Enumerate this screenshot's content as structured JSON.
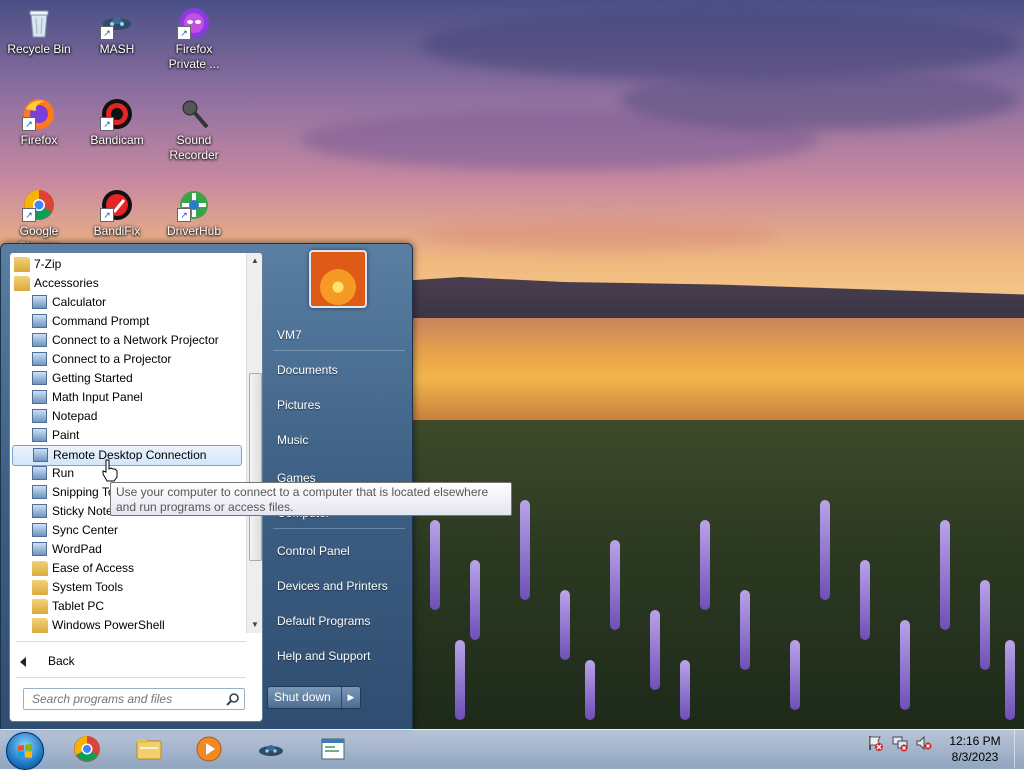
{
  "desktop": {
    "icons": [
      {
        "label": "Recycle Bin"
      },
      {
        "label": "MASH"
      },
      {
        "label": "Firefox Private ..."
      },
      {
        "label": "Firefox"
      },
      {
        "label": "Bandicam"
      },
      {
        "label": "Sound Recorder"
      },
      {
        "label": "Google Chrome"
      },
      {
        "label": "BandiFix"
      },
      {
        "label": "DriverHub"
      }
    ]
  },
  "start_menu": {
    "programs": [
      {
        "label": "7-Zip",
        "type": "folder"
      },
      {
        "label": "Accessories",
        "type": "folder"
      },
      {
        "label": "Calculator",
        "type": "app"
      },
      {
        "label": "Command Prompt",
        "type": "app"
      },
      {
        "label": "Connect to a Network Projector",
        "type": "app"
      },
      {
        "label": "Connect to a Projector",
        "type": "app"
      },
      {
        "label": "Getting Started",
        "type": "app"
      },
      {
        "label": "Math Input Panel",
        "type": "app"
      },
      {
        "label": "Notepad",
        "type": "app"
      },
      {
        "label": "Paint",
        "type": "app"
      },
      {
        "label": "Remote Desktop Connection",
        "type": "app",
        "highlighted": true
      },
      {
        "label": "Run",
        "type": "app"
      },
      {
        "label": "Snipping Tool",
        "type": "app"
      },
      {
        "label": "Sticky Notes",
        "type": "app"
      },
      {
        "label": "Sync Center",
        "type": "app"
      },
      {
        "label": "WordPad",
        "type": "app"
      },
      {
        "label": "Ease of Access",
        "type": "folder"
      },
      {
        "label": "System Tools",
        "type": "folder"
      },
      {
        "label": "Tablet PC",
        "type": "folder"
      },
      {
        "label": "Windows PowerShell",
        "type": "folder"
      }
    ],
    "back_label": "Back",
    "search_placeholder": "Search programs and files",
    "right_items": [
      "VM7",
      "Documents",
      "Pictures",
      "Music",
      "Games",
      "Computer",
      "Control Panel",
      "Devices and Printers",
      "Default Programs",
      "Help and Support"
    ],
    "shutdown_label": "Shut down"
  },
  "tooltip": {
    "text": "Use your computer to connect to a computer that is located elsewhere and run programs or access files."
  },
  "taskbar": {
    "pinned": [
      "chrome-icon",
      "explorer-icon",
      "media-player-icon",
      "mash-icon",
      "app-window-icon"
    ],
    "clock_time": "12:16 PM",
    "clock_date": "8/3/2023"
  }
}
